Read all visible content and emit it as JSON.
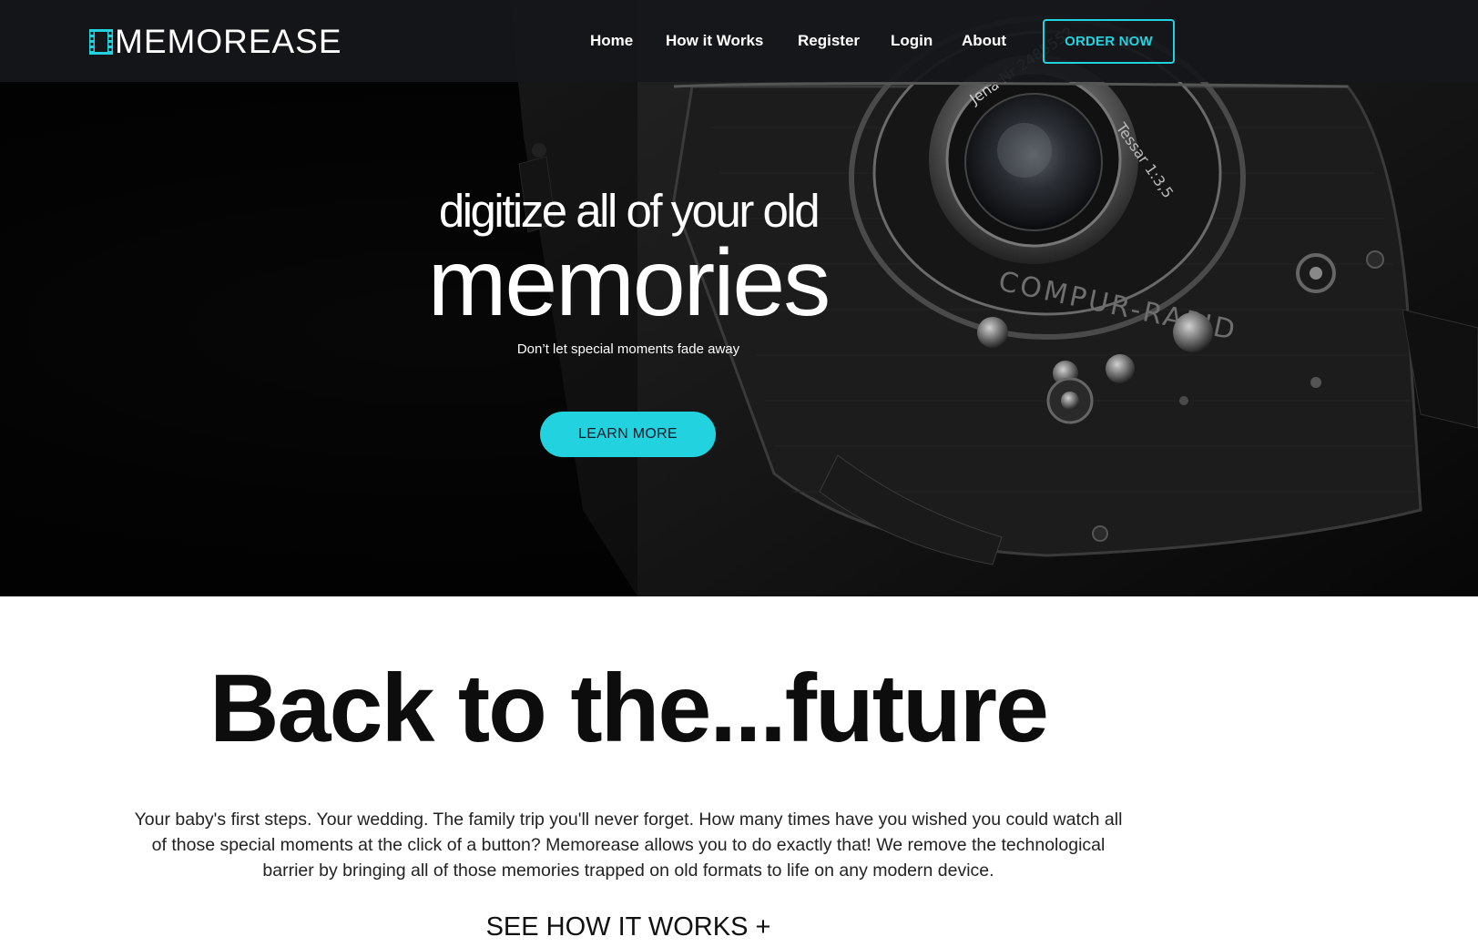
{
  "brand": {
    "name": "MEMOREASE",
    "accent_color": "#22d3df",
    "logo_icon": "film-strip-icon"
  },
  "nav": {
    "items": [
      {
        "label": "Home"
      },
      {
        "label": "How it Works"
      },
      {
        "label": "Register"
      },
      {
        "label": "Login"
      },
      {
        "label": "About"
      }
    ],
    "cta_label": "ORDER NOW"
  },
  "hero": {
    "line1": "digitize all of your old",
    "line2": "memories",
    "tagline": "Don’t let special moments fade away",
    "button_label": "LEARN MORE",
    "background_image": "vintage-camera-photo"
  },
  "section": {
    "title": "Back to the...future",
    "body": "Your baby's first steps. Your wedding. The family trip you'll never forget. How many times have you wished you could watch all of those special moments at the click of a button? Memorease allows you to do exactly that! We remove the technological barrier by bringing all of those memories trapped on old formats to life on any modern device.",
    "link_label": "SEE HOW IT WORKS +"
  }
}
